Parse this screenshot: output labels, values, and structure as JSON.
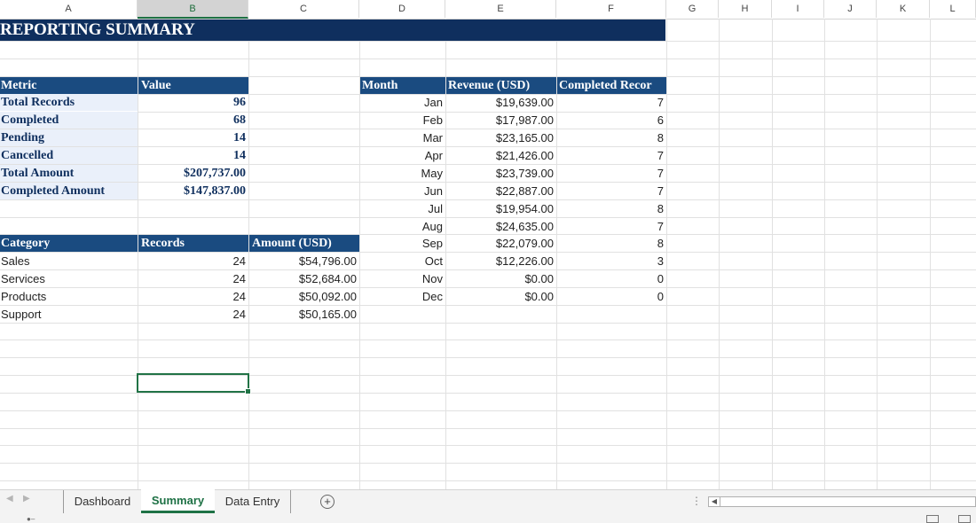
{
  "columns": [
    "A",
    "B",
    "C",
    "D",
    "E",
    "F",
    "G",
    "H",
    "I",
    "J",
    "K",
    "L"
  ],
  "selected_column": "B",
  "title": "REPORTING SUMMARY",
  "metrics_table": {
    "headers": [
      "Metric",
      "Value"
    ],
    "rows": [
      {
        "label": "Total Records",
        "value": "96"
      },
      {
        "label": "Completed",
        "value": "68"
      },
      {
        "label": "Pending",
        "value": "14"
      },
      {
        "label": "Cancelled",
        "value": "14"
      },
      {
        "label": "Total Amount",
        "value": "$207,737.00"
      },
      {
        "label": "Completed Amount",
        "value": "$147,837.00"
      }
    ]
  },
  "category_table": {
    "headers": [
      "Category",
      "Records",
      "Amount (USD)"
    ],
    "rows": [
      {
        "category": "Sales",
        "records": "24",
        "amount": "$54,796.00"
      },
      {
        "category": "Services",
        "records": "24",
        "amount": "$52,684.00"
      },
      {
        "category": "Products",
        "records": "24",
        "amount": "$50,092.00"
      },
      {
        "category": "Support",
        "records": "24",
        "amount": "$50,165.00"
      }
    ]
  },
  "month_table": {
    "headers": [
      "Month",
      "Revenue (USD)",
      "Completed Recor"
    ],
    "rows": [
      {
        "month": "Jan",
        "revenue": "$19,639.00",
        "completed": "7"
      },
      {
        "month": "Feb",
        "revenue": "$17,987.00",
        "completed": "6"
      },
      {
        "month": "Mar",
        "revenue": "$23,165.00",
        "completed": "8"
      },
      {
        "month": "Apr",
        "revenue": "$21,426.00",
        "completed": "7"
      },
      {
        "month": "May",
        "revenue": "$23,739.00",
        "completed": "7"
      },
      {
        "month": "Jun",
        "revenue": "$22,887.00",
        "completed": "7"
      },
      {
        "month": "Jul",
        "revenue": "$19,954.00",
        "completed": "8"
      },
      {
        "month": "Aug",
        "revenue": "$24,635.00",
        "completed": "7"
      },
      {
        "month": "Sep",
        "revenue": "$22,079.00",
        "completed": "8"
      },
      {
        "month": "Oct",
        "revenue": "$12,226.00",
        "completed": "3"
      },
      {
        "month": "Nov",
        "revenue": "$0.00",
        "completed": "0"
      },
      {
        "month": "Dec",
        "revenue": "$0.00",
        "completed": "0"
      }
    ]
  },
  "sheet_tabs": {
    "items": [
      "Dashboard",
      "Summary",
      "Data Entry"
    ],
    "active": "Summary",
    "add_glyph": "+"
  },
  "colors": {
    "title_bg": "#0f2f5e",
    "header_bg": "#1a4b80",
    "metric_bg": "#eaf0fa",
    "accent_green": "#1e7145"
  }
}
